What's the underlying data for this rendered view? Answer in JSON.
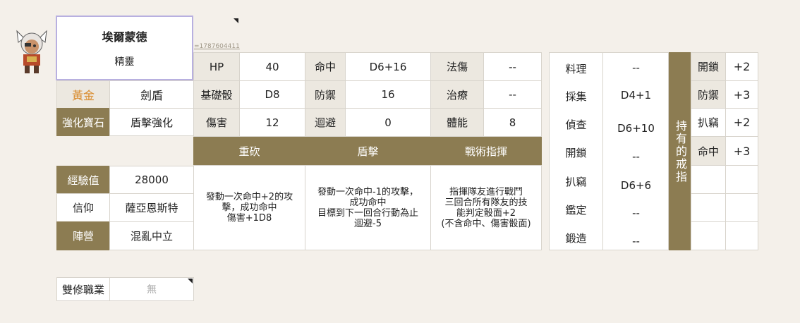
{
  "character": {
    "name": "埃爾蒙德",
    "race": "精靈",
    "link_text": "=1787604411",
    "rank": "黃金",
    "weapon_type": "劍盾",
    "gem_label": "強化寶石",
    "gem_value": "盾擊強化",
    "rank_color": "#d98a2a"
  },
  "stats": [
    {
      "label": "HP",
      "value": "40"
    },
    {
      "label": "基礎骰",
      "value": "D8"
    },
    {
      "label": "傷害",
      "value": "12"
    },
    {
      "label": "命中",
      "value": "D6+16"
    },
    {
      "label": "防禦",
      "value": "16"
    },
    {
      "label": "迴避",
      "value": "0"
    },
    {
      "label": "法傷",
      "value": "--"
    },
    {
      "label": "治療",
      "value": "--"
    },
    {
      "label": "體能",
      "value": "8"
    }
  ],
  "skills": [
    {
      "name": "重砍",
      "desc": "發動一次命中+2的攻擊，成功命中\n傷害+1D8"
    },
    {
      "name": "盾擊",
      "desc": "發動一次命中-1的攻擊，\n成功命中\n目標到下一回合行動為止\n迴避-5"
    },
    {
      "name": "戰術指揮",
      "desc": "指揮隊友進行戰鬥\n三回合所有隊友的技\n能判定骰面+2\n(不含命中、傷害骰面)"
    }
  ],
  "profile": {
    "exp_label": "經驗值",
    "exp_value": "28000",
    "faith_label": "信仰",
    "faith_value": "薩亞恩斯特",
    "camp_label": "陣營",
    "camp_value": "混亂中立"
  },
  "life_skills": [
    {
      "label": "料理",
      "value": "--"
    },
    {
      "label": "採集",
      "value": "D4+1"
    },
    {
      "label": "偵查",
      "value": "D6+10"
    },
    {
      "label": "開鎖",
      "value": "--"
    },
    {
      "label": "扒竊",
      "value": "D6+6"
    },
    {
      "label": "鑑定",
      "value": "--"
    },
    {
      "label": "鍛造",
      "value": "--"
    }
  ],
  "rings": {
    "header": "持有的戒指",
    "bonuses": [
      {
        "label": "開鎖",
        "value": "+2"
      },
      {
        "label": "防禦",
        "value": "+3"
      },
      {
        "label": "扒竊",
        "value": "+2"
      },
      {
        "label": "命中",
        "value": "+3"
      }
    ]
  },
  "dual_class": {
    "label": "雙修職業",
    "value": "無"
  }
}
